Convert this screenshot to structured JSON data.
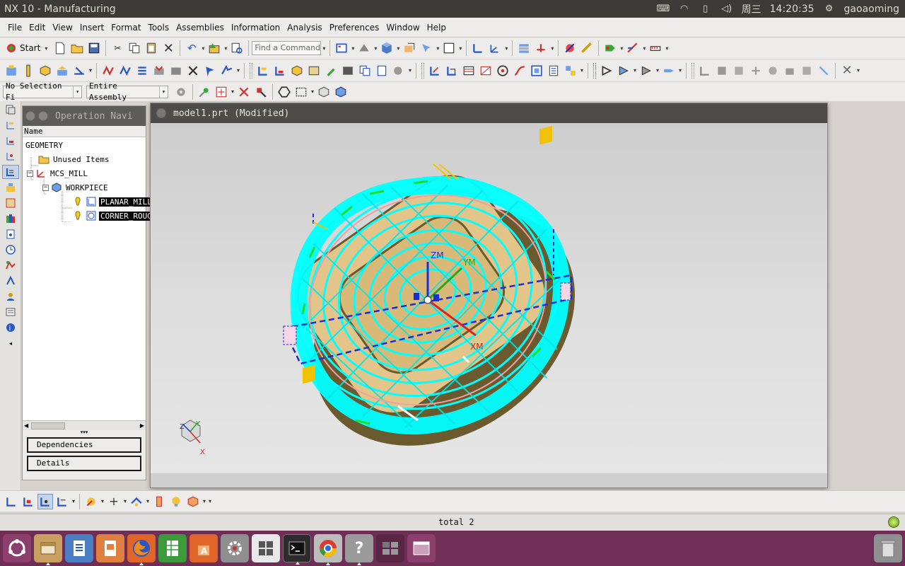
{
  "window": {
    "title": "NX 10 - Manufacturing"
  },
  "system_tray": {
    "day": "周三",
    "time": "14:20:35",
    "user": "gaoaoming"
  },
  "menu": [
    {
      "label": "File",
      "accel": "F"
    },
    {
      "label": "Edit",
      "accel": "E"
    },
    {
      "label": "View",
      "accel": "V"
    },
    {
      "label": "Insert",
      "accel": "s"
    },
    {
      "label": "Format",
      "accel": "o"
    },
    {
      "label": "Tools",
      "accel": "T"
    },
    {
      "label": "Assemblies",
      "accel": "A"
    },
    {
      "label": "Information",
      "accel": "I"
    },
    {
      "label": "Analysis",
      "accel": "l"
    },
    {
      "label": "Preferences",
      "accel": "P"
    },
    {
      "label": "Window",
      "accel": "W"
    },
    {
      "label": "Help",
      "accel": "H"
    }
  ],
  "toolbar": {
    "start_label": "Start",
    "find_placeholder": "Find a Command",
    "selection_filter": "No Selection Fi",
    "selection_scope": "Entire Assembly"
  },
  "navigator": {
    "title": "Operation Navi",
    "column_name": "Name",
    "root": "GEOMETRY",
    "nodes": [
      {
        "label": "Unused Items"
      },
      {
        "label": "MCS_MILL"
      },
      {
        "label": "WORKPIECE"
      },
      {
        "label": "PLANAR_MILL"
      },
      {
        "label": "CORNER_ROUGH"
      }
    ],
    "dependencies_label": "Dependencies",
    "details_label": "Details"
  },
  "graphics": {
    "title": "model1.prt (Modified)",
    "axis_zm": "ZM",
    "axis_ym": "YM",
    "axis_xm": "XM",
    "triad_x": "X",
    "triad_y": "Y",
    "triad_z": "Z"
  },
  "status": {
    "text": "total 2"
  },
  "colors": {
    "toolpath": "#00ffff",
    "part": "#e3c58a",
    "part_shadow": "#6b5a2e",
    "dock_bg": "#6e2e55"
  },
  "dock": [
    "ubuntu-dash-icon",
    "files-icon",
    "writer-icon",
    "impress-icon",
    "firefox-icon",
    "calc-icon",
    "software-center-icon",
    "settings-icon",
    "keyboard-icon",
    "terminal-icon",
    "chrome-icon",
    "help-icon",
    "workspace-icon",
    "window-icon",
    "trash-icon"
  ]
}
